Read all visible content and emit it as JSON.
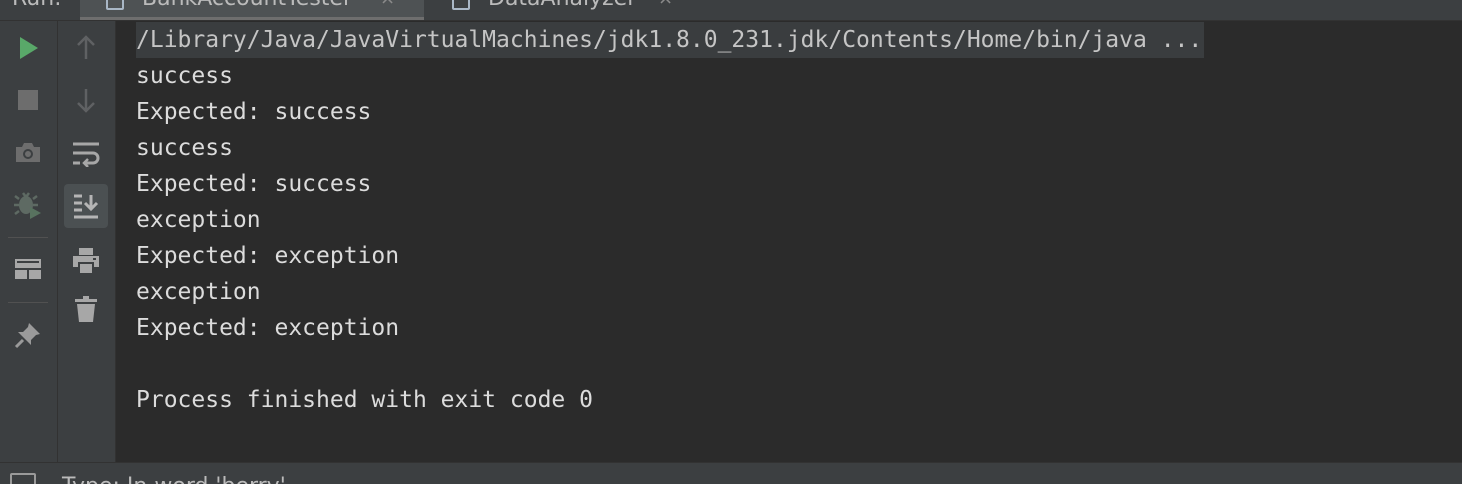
{
  "tabbar": {
    "run_label": "Run:",
    "tabs": [
      {
        "title": "BankAccountTester",
        "close": "×"
      },
      {
        "title": "DataAnalyzer",
        "close": "×"
      }
    ]
  },
  "toolbar": {
    "col1": [
      "rerun-icon",
      "stop-icon",
      "camera-icon",
      "debug-icon",
      "layout-icon",
      "pin-icon"
    ],
    "col2": [
      "up-arrow-icon",
      "down-arrow-icon",
      "soft-wrap-icon",
      "scroll-to-end-icon",
      "print-icon",
      "trash-icon"
    ]
  },
  "console": {
    "command": "/Library/Java/JavaVirtualMachines/jdk1.8.0_231.jdk/Contents/Home/bin/java ...",
    "lines": [
      "success",
      "Expected: success",
      "success",
      "Expected: success",
      "exception",
      "Expected: exception",
      "exception",
      "Expected: exception",
      "",
      "Process finished with exit code 0"
    ]
  },
  "statusbar": {
    "text": "Type: In word 'berry'"
  },
  "colors": {
    "background": "#2b2b2b",
    "panel": "#3c3f41",
    "run_green": "#59a869",
    "icon_gray": "#9a9a9a",
    "text": "#dcdcdc"
  }
}
